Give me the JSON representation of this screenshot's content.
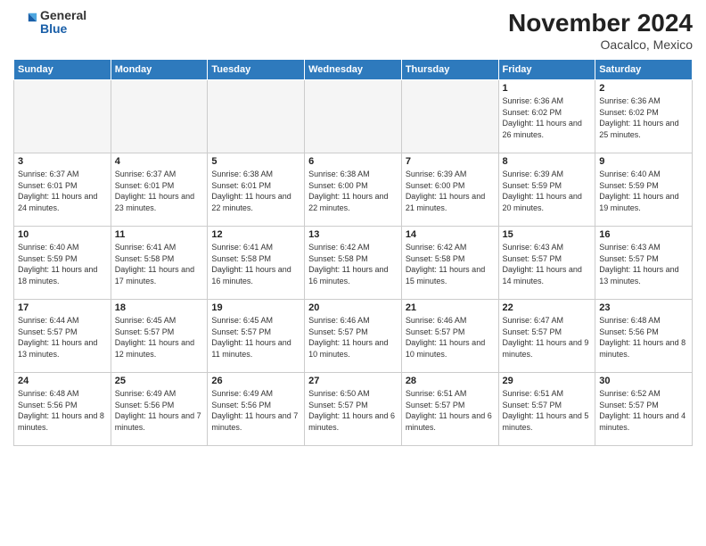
{
  "header": {
    "logo_general": "General",
    "logo_blue": "Blue",
    "month_title": "November 2024",
    "location": "Oacalco, Mexico"
  },
  "days_of_week": [
    "Sunday",
    "Monday",
    "Tuesday",
    "Wednesday",
    "Thursday",
    "Friday",
    "Saturday"
  ],
  "weeks": [
    [
      {
        "day": "",
        "info": ""
      },
      {
        "day": "",
        "info": ""
      },
      {
        "day": "",
        "info": ""
      },
      {
        "day": "",
        "info": ""
      },
      {
        "day": "",
        "info": ""
      },
      {
        "day": "1",
        "info": "Sunrise: 6:36 AM\nSunset: 6:02 PM\nDaylight: 11 hours and 26 minutes."
      },
      {
        "day": "2",
        "info": "Sunrise: 6:36 AM\nSunset: 6:02 PM\nDaylight: 11 hours and 25 minutes."
      }
    ],
    [
      {
        "day": "3",
        "info": "Sunrise: 6:37 AM\nSunset: 6:01 PM\nDaylight: 11 hours and 24 minutes."
      },
      {
        "day": "4",
        "info": "Sunrise: 6:37 AM\nSunset: 6:01 PM\nDaylight: 11 hours and 23 minutes."
      },
      {
        "day": "5",
        "info": "Sunrise: 6:38 AM\nSunset: 6:01 PM\nDaylight: 11 hours and 22 minutes."
      },
      {
        "day": "6",
        "info": "Sunrise: 6:38 AM\nSunset: 6:00 PM\nDaylight: 11 hours and 22 minutes."
      },
      {
        "day": "7",
        "info": "Sunrise: 6:39 AM\nSunset: 6:00 PM\nDaylight: 11 hours and 21 minutes."
      },
      {
        "day": "8",
        "info": "Sunrise: 6:39 AM\nSunset: 5:59 PM\nDaylight: 11 hours and 20 minutes."
      },
      {
        "day": "9",
        "info": "Sunrise: 6:40 AM\nSunset: 5:59 PM\nDaylight: 11 hours and 19 minutes."
      }
    ],
    [
      {
        "day": "10",
        "info": "Sunrise: 6:40 AM\nSunset: 5:59 PM\nDaylight: 11 hours and 18 minutes."
      },
      {
        "day": "11",
        "info": "Sunrise: 6:41 AM\nSunset: 5:58 PM\nDaylight: 11 hours and 17 minutes."
      },
      {
        "day": "12",
        "info": "Sunrise: 6:41 AM\nSunset: 5:58 PM\nDaylight: 11 hours and 16 minutes."
      },
      {
        "day": "13",
        "info": "Sunrise: 6:42 AM\nSunset: 5:58 PM\nDaylight: 11 hours and 16 minutes."
      },
      {
        "day": "14",
        "info": "Sunrise: 6:42 AM\nSunset: 5:58 PM\nDaylight: 11 hours and 15 minutes."
      },
      {
        "day": "15",
        "info": "Sunrise: 6:43 AM\nSunset: 5:57 PM\nDaylight: 11 hours and 14 minutes."
      },
      {
        "day": "16",
        "info": "Sunrise: 6:43 AM\nSunset: 5:57 PM\nDaylight: 11 hours and 13 minutes."
      }
    ],
    [
      {
        "day": "17",
        "info": "Sunrise: 6:44 AM\nSunset: 5:57 PM\nDaylight: 11 hours and 13 minutes."
      },
      {
        "day": "18",
        "info": "Sunrise: 6:45 AM\nSunset: 5:57 PM\nDaylight: 11 hours and 12 minutes."
      },
      {
        "day": "19",
        "info": "Sunrise: 6:45 AM\nSunset: 5:57 PM\nDaylight: 11 hours and 11 minutes."
      },
      {
        "day": "20",
        "info": "Sunrise: 6:46 AM\nSunset: 5:57 PM\nDaylight: 11 hours and 10 minutes."
      },
      {
        "day": "21",
        "info": "Sunrise: 6:46 AM\nSunset: 5:57 PM\nDaylight: 11 hours and 10 minutes."
      },
      {
        "day": "22",
        "info": "Sunrise: 6:47 AM\nSunset: 5:57 PM\nDaylight: 11 hours and 9 minutes."
      },
      {
        "day": "23",
        "info": "Sunrise: 6:48 AM\nSunset: 5:56 PM\nDaylight: 11 hours and 8 minutes."
      }
    ],
    [
      {
        "day": "24",
        "info": "Sunrise: 6:48 AM\nSunset: 5:56 PM\nDaylight: 11 hours and 8 minutes."
      },
      {
        "day": "25",
        "info": "Sunrise: 6:49 AM\nSunset: 5:56 PM\nDaylight: 11 hours and 7 minutes."
      },
      {
        "day": "26",
        "info": "Sunrise: 6:49 AM\nSunset: 5:56 PM\nDaylight: 11 hours and 7 minutes."
      },
      {
        "day": "27",
        "info": "Sunrise: 6:50 AM\nSunset: 5:57 PM\nDaylight: 11 hours and 6 minutes."
      },
      {
        "day": "28",
        "info": "Sunrise: 6:51 AM\nSunset: 5:57 PM\nDaylight: 11 hours and 6 minutes."
      },
      {
        "day": "29",
        "info": "Sunrise: 6:51 AM\nSunset: 5:57 PM\nDaylight: 11 hours and 5 minutes."
      },
      {
        "day": "30",
        "info": "Sunrise: 6:52 AM\nSunset: 5:57 PM\nDaylight: 11 hours and 4 minutes."
      }
    ]
  ]
}
